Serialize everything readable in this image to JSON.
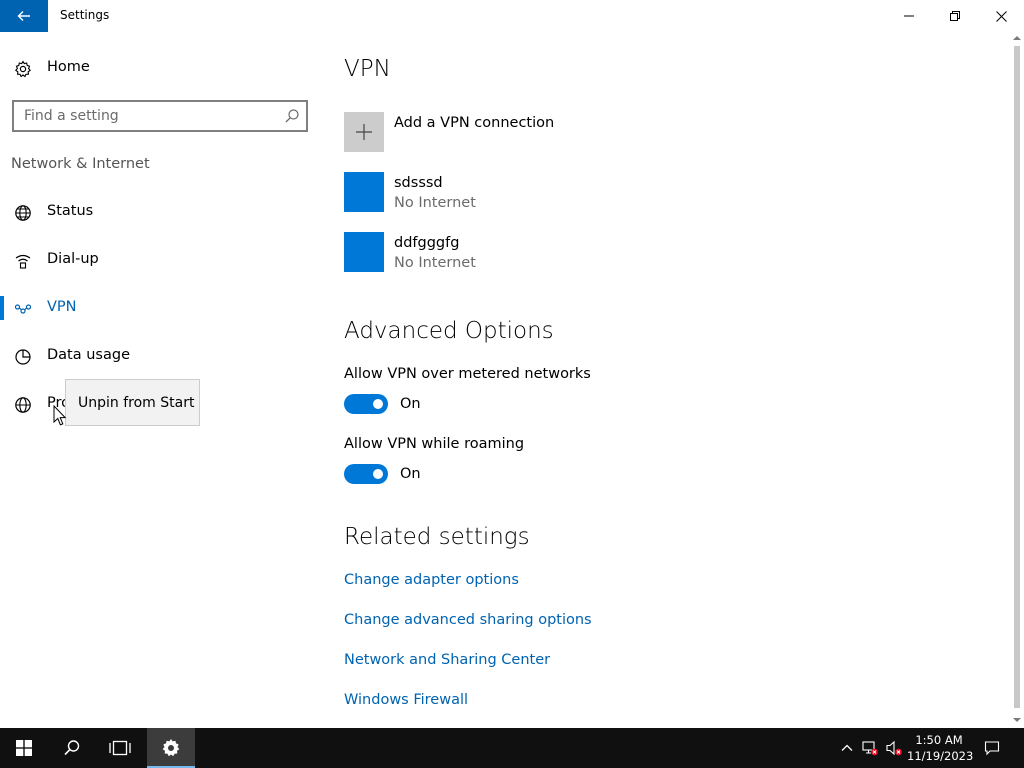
{
  "window": {
    "title": "Settings"
  },
  "sidebar": {
    "home_label": "Home",
    "search_placeholder": "Find a setting",
    "section_label": "Network & Internet",
    "items": [
      {
        "label": "Status",
        "icon": "globe-icon"
      },
      {
        "label": "Dial-up",
        "icon": "dialup-icon"
      },
      {
        "label": "VPN",
        "icon": "vpn-icon",
        "selected": true
      },
      {
        "label": "Data usage",
        "icon": "data-usage-icon"
      },
      {
        "label": "Pro",
        "icon": "proxy-globe-icon"
      }
    ]
  },
  "tooltip": {
    "text": "Unpin from Start"
  },
  "main": {
    "heading": "VPN",
    "add_vpn_label": "Add a VPN connection",
    "connections": [
      {
        "name": "sdsssd",
        "status": "No Internet"
      },
      {
        "name": "ddfgggfg",
        "status": "No Internet"
      }
    ],
    "advanced": {
      "heading": "Advanced Options",
      "options": [
        {
          "label": "Allow VPN over metered networks",
          "state": "On"
        },
        {
          "label": "Allow VPN while roaming",
          "state": "On"
        }
      ]
    },
    "related": {
      "heading": "Related settings",
      "links": [
        "Change adapter options",
        "Change advanced sharing options",
        "Network and Sharing Center",
        "Windows Firewall"
      ]
    }
  },
  "taskbar": {
    "time": "1:50 AM",
    "date": "11/19/2023"
  },
  "colors": {
    "accent": "#0078d7",
    "accent_dark": "#0063b1",
    "taskbar": "#101010",
    "tile_gray": "#cccccc"
  }
}
